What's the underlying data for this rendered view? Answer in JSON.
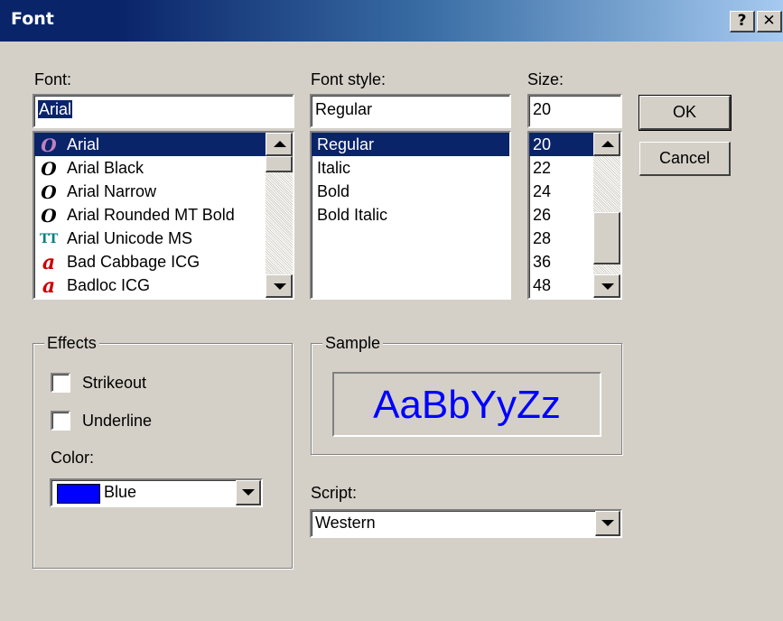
{
  "window": {
    "title": "Font",
    "help_label": "?",
    "close_label": "✕"
  },
  "font": {
    "label": "Font:",
    "value": "Arial",
    "items": [
      {
        "name": "Arial",
        "icon": "O",
        "icon_kind": "opentype",
        "selected": true
      },
      {
        "name": "Arial Black",
        "icon": "O",
        "icon_kind": "opentype"
      },
      {
        "name": "Arial Narrow",
        "icon": "O",
        "icon_kind": "opentype"
      },
      {
        "name": "Arial Rounded MT Bold",
        "icon": "O",
        "icon_kind": "opentype"
      },
      {
        "name": "Arial Unicode MS",
        "icon": "TT",
        "icon_kind": "truetype"
      },
      {
        "name": "Bad Cabbage ICG",
        "icon": "a",
        "icon_kind": "type1"
      },
      {
        "name": "Badloc ICG",
        "icon": "a",
        "icon_kind": "type1"
      }
    ]
  },
  "style": {
    "label": "Font style:",
    "value": "Regular",
    "items": [
      "Regular",
      "Italic",
      "Bold",
      "Bold Italic"
    ],
    "selected_index": 0
  },
  "size": {
    "label": "Size:",
    "value": "20",
    "items": [
      "20",
      "22",
      "24",
      "26",
      "28",
      "36",
      "48"
    ],
    "selected_index": 0
  },
  "buttons": {
    "ok": "OK",
    "cancel": "Cancel"
  },
  "effects": {
    "label": "Effects",
    "strikeout": {
      "label": "Strikeout",
      "checked": false
    },
    "underline": {
      "label": "Underline",
      "checked": false
    },
    "color_label": "Color:",
    "color_value": "Blue",
    "color_hex": "#0000ff"
  },
  "sample": {
    "label": "Sample",
    "text": "AaBbYyZz"
  },
  "script": {
    "label": "Script:",
    "value": "Western"
  },
  "colors": {
    "selection": "#0a246a",
    "face": "#d4d0c8",
    "opentype_icon": "#000000",
    "truetype_icon": "#008080",
    "type1_icon": "#cc0000"
  }
}
